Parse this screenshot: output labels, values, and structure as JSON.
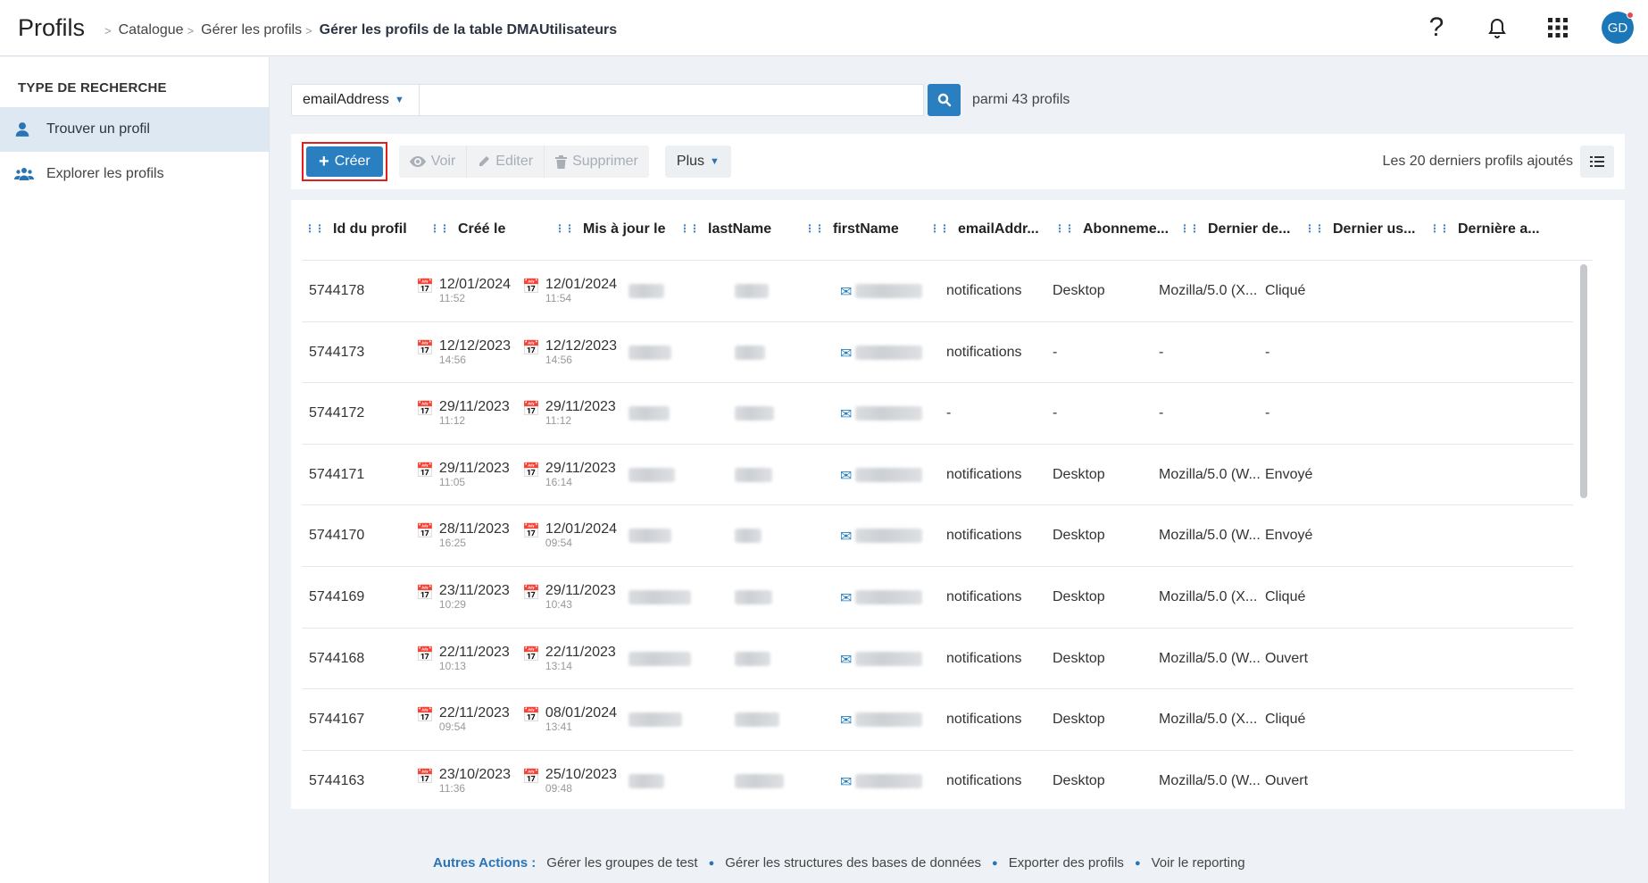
{
  "header": {
    "title": "Profils",
    "breadcrumbs": [
      "Catalogue",
      "Gérer les profils",
      "Gérer les profils de la table DMAUtilisateurs"
    ],
    "help": "?",
    "avatar_initials": "GD"
  },
  "sidebar": {
    "heading": "TYPE DE RECHERCHE",
    "items": [
      {
        "label": "Trouver un profil",
        "icon": "user-icon",
        "active": true
      },
      {
        "label": "Explorer les profils",
        "icon": "users-icon",
        "active": false
      }
    ]
  },
  "search": {
    "field": "emailAddress",
    "value": "",
    "count_text": "parmi 43 profils"
  },
  "toolbar": {
    "create": "Créer",
    "view": "Voir",
    "edit": "Editer",
    "delete": "Supprimer",
    "more": "Plus",
    "recent": "Les 20 derniers profils ajoutés"
  },
  "table": {
    "columns": [
      "Id du profil",
      "Créé le",
      "Mis à jour le",
      "lastName",
      "firstName",
      "emailAddr...",
      "Abonneme...",
      "Dernier de...",
      "Dernier us...",
      "Dernière a..."
    ],
    "rows": [
      {
        "id": "5744178",
        "created_date": "12/01/2024",
        "created_time": "11:52",
        "updated_date": "12/01/2024",
        "updated_time": "11:54",
        "subscription": "notifications",
        "device": "Desktop",
        "useragent": "Mozilla/5.0 (X...",
        "action": "Cliqué"
      },
      {
        "id": "5744173",
        "created_date": "12/12/2023",
        "created_time": "14:56",
        "updated_date": "12/12/2023",
        "updated_time": "14:56",
        "subscription": "notifications",
        "device": "-",
        "useragent": "-",
        "action": "-"
      },
      {
        "id": "5744172",
        "created_date": "29/11/2023",
        "created_time": "11:12",
        "updated_date": "29/11/2023",
        "updated_time": "11:12",
        "subscription": "-",
        "device": "-",
        "useragent": "-",
        "action": "-"
      },
      {
        "id": "5744171",
        "created_date": "29/11/2023",
        "created_time": "11:05",
        "updated_date": "29/11/2023",
        "updated_time": "16:14",
        "subscription": "notifications",
        "device": "Desktop",
        "useragent": "Mozilla/5.0 (W...",
        "action": "Envoyé"
      },
      {
        "id": "5744170",
        "created_date": "28/11/2023",
        "created_time": "16:25",
        "updated_date": "12/01/2024",
        "updated_time": "09:54",
        "subscription": "notifications",
        "device": "Desktop",
        "useragent": "Mozilla/5.0 (W...",
        "action": "Envoyé"
      },
      {
        "id": "5744169",
        "created_date": "23/11/2023",
        "created_time": "10:29",
        "updated_date": "29/11/2023",
        "updated_time": "10:43",
        "subscription": "notifications",
        "device": "Desktop",
        "useragent": "Mozilla/5.0 (X...",
        "action": "Cliqué"
      },
      {
        "id": "5744168",
        "created_date": "22/11/2023",
        "created_time": "10:13",
        "updated_date": "22/11/2023",
        "updated_time": "13:14",
        "subscription": "notifications",
        "device": "Desktop",
        "useragent": "Mozilla/5.0 (W...",
        "action": "Ouvert"
      },
      {
        "id": "5744167",
        "created_date": "22/11/2023",
        "created_time": "09:54",
        "updated_date": "08/01/2024",
        "updated_time": "13:41",
        "subscription": "notifications",
        "device": "Desktop",
        "useragent": "Mozilla/5.0 (X...",
        "action": "Cliqué"
      },
      {
        "id": "5744163",
        "created_date": "23/10/2023",
        "created_time": "11:36",
        "updated_date": "25/10/2023",
        "updated_time": "09:48",
        "subscription": "notifications",
        "device": "Desktop",
        "useragent": "Mozilla/5.0 (W...",
        "action": "Ouvert"
      }
    ]
  },
  "footer": {
    "label": "Autres Actions :",
    "links": [
      "Gérer les groupes de test",
      "Gérer les structures des bases de données",
      "Exporter des profils",
      "Voir le reporting"
    ]
  },
  "colors": {
    "accent": "#2a7fc1",
    "highlight": "#e02020",
    "sidebar_active": "#dde8f2",
    "background": "#eef2f6"
  }
}
